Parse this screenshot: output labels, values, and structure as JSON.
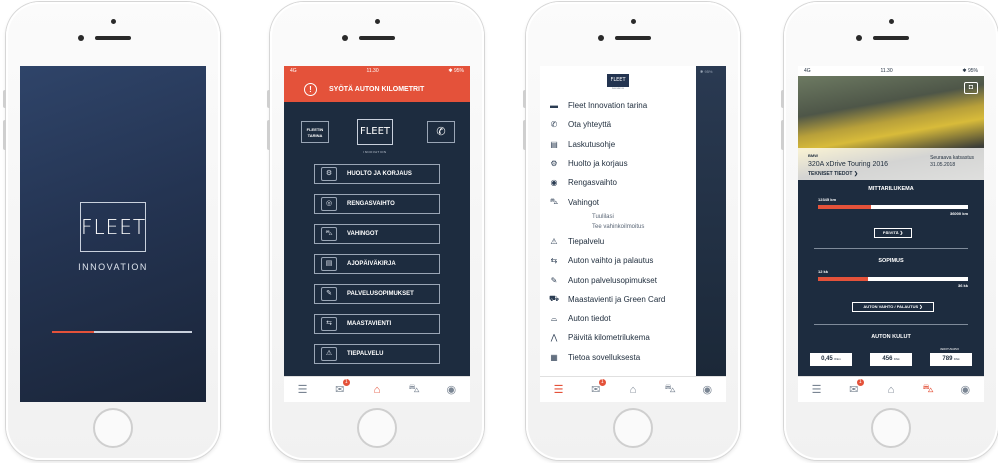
{
  "colors": {
    "accent": "#e4523a",
    "navy": "#1d2c3f",
    "white": "#ffffff"
  },
  "phone1": {
    "logo": "FLEET",
    "tagline": "INNOVATION",
    "loading_progress": 0.3
  },
  "phone2": {
    "status": {
      "carrier": "4G",
      "time": "11.30",
      "battery": "✱ 95%"
    },
    "alert": "SYÖTÄ AUTON KILOMETRIT",
    "story": [
      "FLEETIN",
      "TARINA"
    ],
    "logo": "FLEET",
    "tagline": "INNOVATION",
    "menu": [
      {
        "label": "HUOLTO JA KORJAUS",
        "icon": "service-icon"
      },
      {
        "label": "RENGASVAIHTO",
        "icon": "tire-icon"
      },
      {
        "label": "VAHINGOT",
        "icon": "damage-car-icon"
      },
      {
        "label": "AJOPÄIVÄKIRJA",
        "icon": "logbook-icon"
      },
      {
        "label": "PALVELUSOPIMUKSET",
        "icon": "contract-car-icon"
      },
      {
        "label": "MAASTAVIENTI",
        "icon": "export-car-icon"
      },
      {
        "label": "TIEPALVELU",
        "icon": "tow-truck-icon"
      }
    ],
    "tabs": [
      "menu-icon",
      "mail-icon",
      "home-icon",
      "car-icon",
      "user-icon"
    ],
    "badge": "1"
  },
  "phone3": {
    "status": "✱ 95%",
    "logo": "FLEET",
    "logo_sub": "INNOVATION",
    "items": [
      "Fleet Innovation tarina",
      "Ota yhteyttä",
      "Laskutusohje",
      "Huolto ja korjaus",
      "Rengasvaihto",
      "Vahingot"
    ],
    "subitems": [
      "Tuulilasi",
      "Tee vahinkoilmoitus"
    ],
    "items2": [
      "Tiepalvelu",
      "Auton vaihto ja palautus",
      "Auton palvelusopimukset",
      "Maastavienti ja Green Card",
      "Auton tiedot",
      "Päivitä kilometrilukema",
      "Tietoa sovelluksesta"
    ],
    "badge": "1"
  },
  "phone4": {
    "status": {
      "carrier": "4G",
      "time": "11.30",
      "battery": "✱ 95%"
    },
    "car_make": "BMW",
    "car_model": "320A xDrive Touring 2016",
    "tech_link": "TEKNISET TIEDOT ❯",
    "next_label": "Seuraava katsastus",
    "next_date": "31.05.2018",
    "odo_title": "MITTARILUKEMA",
    "odo_current": "12345 km",
    "odo_max": "36000 km",
    "odo_ratio": 0.35,
    "update_btn": "PÄIVITÄ ❯",
    "contract_title": "SOPIMUS",
    "contract_current": "12 kk",
    "contract_max": "36 kk",
    "contract_ratio": 0.33,
    "swap_btn": "AUTON VAIHTO / PALAUTUS ❯",
    "costs_title": "AUTON KULUT",
    "costs_label": "VEROTUSARVO",
    "costs": [
      {
        "value": "0,45",
        "unit": "€/km"
      },
      {
        "value": "456",
        "unit": "€/kk"
      },
      {
        "value": "789",
        "unit": "€/kk"
      }
    ],
    "badge": "1"
  }
}
